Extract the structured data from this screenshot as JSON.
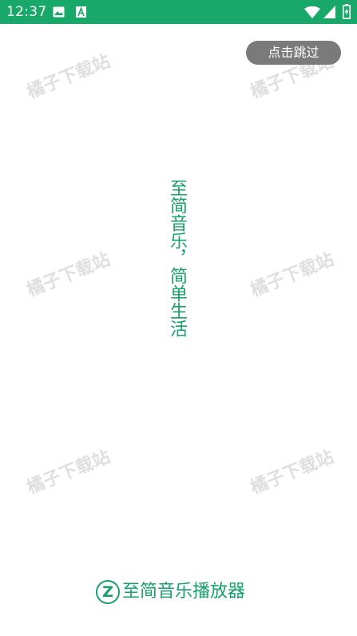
{
  "status_bar": {
    "time": "12:37",
    "background_color": "#17a86a",
    "left_icons": [
      "image-icon",
      "text-a-icon"
    ],
    "right_icons": [
      "wifi-icon",
      "cell-signal-icon",
      "battery-charging-icon"
    ]
  },
  "skip_button": {
    "label": "点击跳过"
  },
  "slogan": {
    "text": "至简音乐，简单生活"
  },
  "watermark": {
    "text": "橘子下载站"
  },
  "brand": {
    "logo_letter": "Z",
    "name": "至简音乐播放器"
  },
  "colors": {
    "accent": "#16a06a",
    "skip_bg": "#7a7a7a",
    "watermark": "#dcdcdc"
  }
}
